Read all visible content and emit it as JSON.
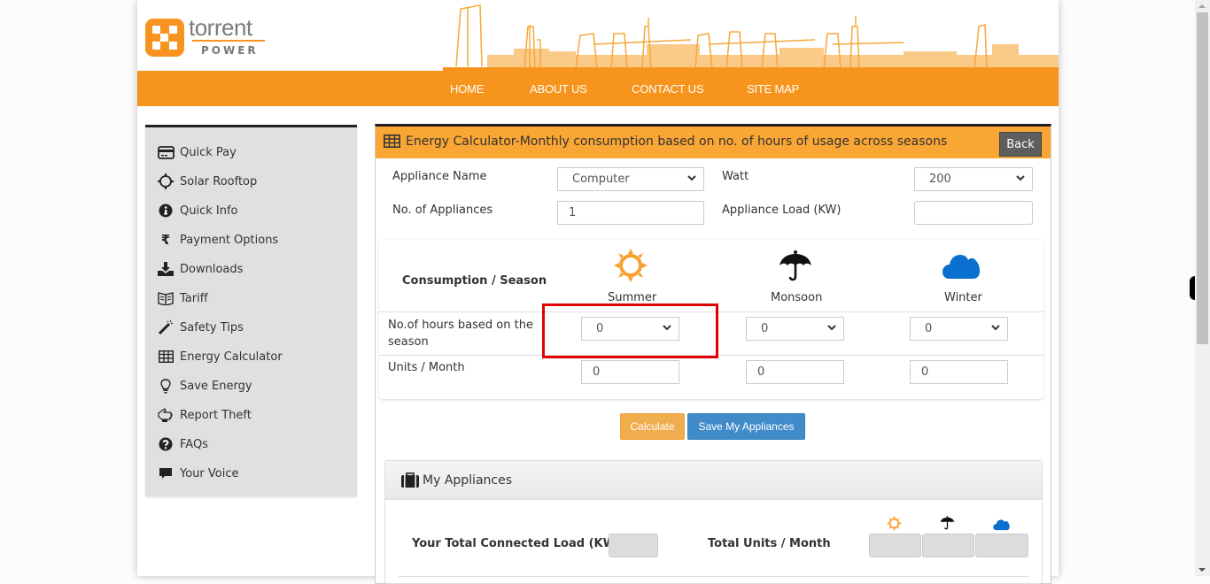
{
  "brand": {
    "name": "torrent",
    "sub": "POWER",
    "accent": "#f7941d",
    "panel_accent": "#faa634"
  },
  "nav": {
    "items": [
      {
        "label": "HOME"
      },
      {
        "label": "ABOUT US"
      },
      {
        "label": "CONTACT US"
      },
      {
        "label": "SITE MAP"
      }
    ]
  },
  "sidebar": {
    "items": [
      {
        "label": "Quick Pay",
        "icon": "credit-card-icon"
      },
      {
        "label": "Solar Rooftop",
        "icon": "sun-outline-icon"
      },
      {
        "label": "Quick Info",
        "icon": "info-circle-icon"
      },
      {
        "label": "Payment Options",
        "icon": "rupee-icon"
      },
      {
        "label": "Downloads",
        "icon": "download-icon"
      },
      {
        "label": "Tariff",
        "icon": "book-icon"
      },
      {
        "label": "Safety Tips",
        "icon": "magic-wand-icon"
      },
      {
        "label": "Energy Calculator",
        "icon": "table-icon"
      },
      {
        "label": "Save Energy",
        "icon": "lightbulb-icon"
      },
      {
        "label": "Report Theft",
        "icon": "hand-pointer-icon"
      },
      {
        "label": "FAQs",
        "icon": "question-circle-icon"
      },
      {
        "label": "Your Voice",
        "icon": "comment-icon"
      }
    ]
  },
  "panel": {
    "title": "Energy Calculator-Monthly consumption based on no. of hours of usage across seasons",
    "back_label": "Back",
    "appliance_name_label": "Appliance Name",
    "appliance_name_value": "Computer",
    "watt_label": "Watt",
    "watt_value": "200",
    "num_appliances_label": "No. of Appliances",
    "num_appliances_value": "1",
    "appliance_load_label": "Appliance Load (KW)",
    "appliance_load_value": "",
    "season_table": {
      "header_label": "Consumption / Season",
      "seasons": [
        {
          "name": "Summer",
          "icon": "sun-icon",
          "color": "#f7a12f"
        },
        {
          "name": "Monsoon",
          "icon": "umbrella-icon",
          "color": "#111111"
        },
        {
          "name": "Winter",
          "icon": "cloud-icon",
          "color": "#0a6fcf"
        }
      ],
      "hours_label": "No.of hours based on the season",
      "hours_values": [
        "0",
        "0",
        "0"
      ],
      "units_label": "Units / Month",
      "units_values": [
        "0",
        "0",
        "0"
      ]
    },
    "calculate_label": "Calculate",
    "save_label": "Save My Appliances",
    "my_appliances": {
      "title": "My Appliances",
      "total_load_label": "Your Total Connected Load (KW)",
      "total_load_value": "",
      "total_units_label": "Total Units / Month",
      "total_units_values": [
        "",
        "",
        ""
      ]
    }
  }
}
